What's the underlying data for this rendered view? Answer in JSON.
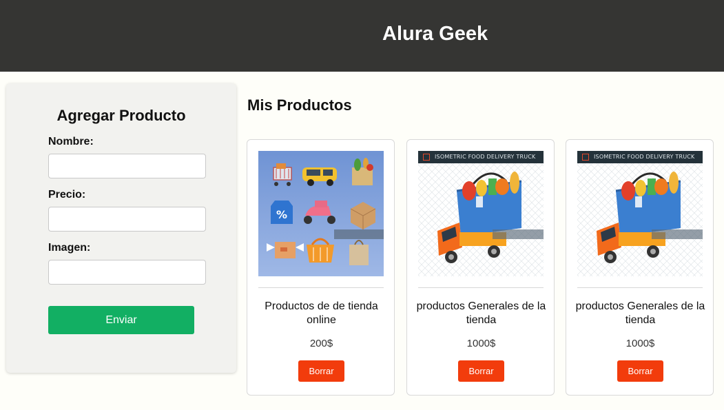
{
  "header": {
    "title": "Alura Geek"
  },
  "form": {
    "title": "Agregar Producto",
    "fields": [
      {
        "label": "Nombre:",
        "value": "",
        "placeholder": ""
      },
      {
        "label": "Precio:",
        "value": "",
        "placeholder": ""
      },
      {
        "label": "Imagen:",
        "value": "",
        "placeholder": ""
      }
    ],
    "submit_label": "Enviar"
  },
  "products": {
    "title": "Mis Productos",
    "items": [
      {
        "name": "Productos de de tienda online",
        "price": "200$",
        "delete_label": "Borrar",
        "image": "online-shopping-icons-image"
      },
      {
        "name": "productos Generales de la tienda",
        "price": "1000$",
        "delete_label": "Borrar",
        "image": "food-delivery-truck-image",
        "image_banner": "ISOMETRIC FOOD DELIVERY TRUCK"
      },
      {
        "name": "productos Generales de la tienda",
        "price": "1000$",
        "delete_label": "Borrar",
        "image": "food-delivery-truck-image",
        "image_banner": "ISOMETRIC FOOD DELIVERY TRUCK"
      }
    ]
  },
  "colors": {
    "header_bg": "#353533",
    "page_bg": "#fefef9",
    "submit_bg": "#12af63",
    "delete_bg": "#f23c0c"
  }
}
